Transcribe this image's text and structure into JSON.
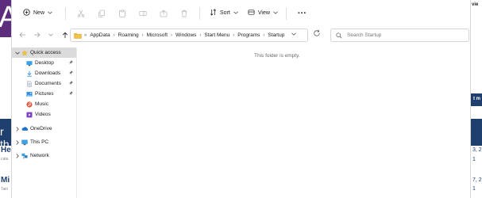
{
  "background": {
    "left_banner_letter": "A",
    "left_strip_text": "r th",
    "left_heading_1": "He",
    "left_sub_1": "cata",
    "left_heading_2": "Mi",
    "left_sub_2": "Tain",
    "right_top_text": "vie",
    "right_tag_text": "t m",
    "right_num_1": "3, 2",
    "right_num_2": "1",
    "right_num_3": "7, 2",
    "right_num_4": "1",
    "accent_purple": "#5b2d7c",
    "accent_navy": "#1f3f6e"
  },
  "command_bar": {
    "new_label": "New",
    "sort_label": "Sort",
    "view_label": "View",
    "more_label": "···",
    "icons": [
      "cut-icon",
      "copy-icon",
      "paste-icon",
      "rename-icon",
      "share-icon",
      "delete-icon"
    ]
  },
  "navigation": {
    "breadcrumb": [
      "AppData",
      "Roaming",
      "Microsoft",
      "Windows",
      "Start Menu",
      "Programs",
      "Startup"
    ],
    "overflow_label": "«",
    "search_placeholder": "Search Startup"
  },
  "nav_pane": {
    "quick_access": "Quick access",
    "quick_items": [
      {
        "label": "Desktop",
        "pinned": true
      },
      {
        "label": "Downloads",
        "pinned": true
      },
      {
        "label": "Documents",
        "pinned": true
      },
      {
        "label": "Pictures",
        "pinned": true
      },
      {
        "label": "Music",
        "pinned": false
      },
      {
        "label": "Videos",
        "pinned": false
      }
    ],
    "onedrive": "OneDrive",
    "this_pc": "This PC",
    "network": "Network"
  },
  "content": {
    "empty_message": "This folder is empty."
  }
}
